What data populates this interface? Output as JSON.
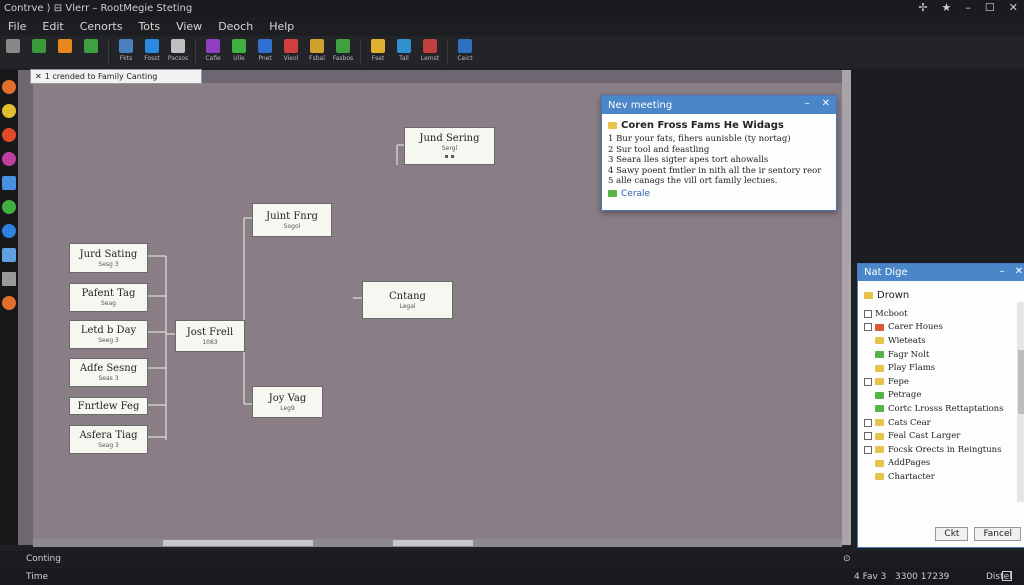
{
  "window": {
    "title": "Contrve ⟩ ⊟ Vlerr – RootMegie Steting"
  },
  "menu": [
    "File",
    "Edit",
    "Cenorts",
    "Tots",
    "View",
    "Deoch",
    "Help"
  ],
  "toolbar": [
    {
      "icon": "gear-icon",
      "label": "",
      "color": "#888"
    },
    {
      "icon": "moon-icon",
      "label": "",
      "color": "#3a9a3a"
    },
    {
      "icon": "hammer-icon",
      "label": "",
      "color": "#e8861c"
    },
    {
      "icon": "leaf-icon",
      "label": "",
      "color": "#40a040"
    },
    {
      "icon": "globe-icon",
      "label": "Fkts",
      "color": "#4a7fc0"
    },
    {
      "icon": "diamond-icon",
      "label": "Fosst",
      "color": "#2a8ae0"
    },
    {
      "icon": "pie-icon",
      "label": "Pacsos",
      "color": "#c0c0c0"
    },
    {
      "icon": "color-wheel-icon",
      "label": "Cafie",
      "color": "#9040c0"
    },
    {
      "icon": "pencil-icon",
      "label": "Ulle",
      "color": "#40b040"
    },
    {
      "icon": "search-icon",
      "label": "Pnet",
      "color": "#3070d0"
    },
    {
      "icon": "grid-icon",
      "label": "Vieol",
      "color": "#d04040"
    },
    {
      "icon": "chart-icon",
      "label": "Fsbal",
      "color": "#d0a030"
    },
    {
      "icon": "table-icon",
      "label": "Fasbos",
      "color": "#40a040"
    },
    {
      "icon": "book-icon",
      "label": "Fset",
      "color": "#e0b030"
    },
    {
      "icon": "image-icon",
      "label": "Tall",
      "color": "#3090d0"
    },
    {
      "icon": "video-icon",
      "label": "Lemst",
      "color": "#c04040"
    },
    {
      "icon": "door-icon",
      "label": "Ceict",
      "color": "#3070c0"
    }
  ],
  "tab": {
    "label": "1 crended to Family Canting"
  },
  "tree": {
    "nodes": [
      {
        "name": "Jund Sering",
        "sub": "Sergl"
      },
      {
        "name": "Juint Fnrg",
        "sub": "Sogol"
      },
      {
        "name": "Cntang",
        "sub": "Legal"
      },
      {
        "name": "Jost Frell",
        "sub": "1083"
      },
      {
        "name": "Joy Vag",
        "sub": "Leg9"
      },
      {
        "name": "Jurd Sating",
        "sub": "Sesg 3"
      },
      {
        "name": "Pafent Tag",
        "sub": "Seag"
      },
      {
        "name": "Letd b Day",
        "sub": "Seeg 3"
      },
      {
        "name": "Adfe Sesng",
        "sub": "Seas 3"
      },
      {
        "name": "Fnrtlew Feg",
        "sub": ""
      },
      {
        "name": "Asfera Tiag",
        "sub": "Seag 3"
      }
    ]
  },
  "dialog1": {
    "title": "Nev meeting",
    "heading": "Coren Fross Fams He Widags",
    "lines": [
      "1  Bur your fats, fihers aunisble (ty nortag)",
      "2  Sur tool and feastling",
      "3  Seara lles sigter apes tort ahowalls",
      "4  Sawy poent fmtler in nith all the ir sentory reor",
      "5  alle canags the vill ort family lectues."
    ],
    "link": "Cerale"
  },
  "dialog2": {
    "title": "Nat Dige",
    "root": "Drown",
    "items": [
      {
        "label": "Mcboot",
        "cb": true,
        "icon": ""
      },
      {
        "label": "Carer Houes",
        "cb": true,
        "icon": "r"
      },
      {
        "label": "Wieteats",
        "cb": false,
        "icon": "y"
      },
      {
        "label": "Fagr Nolt",
        "cb": false,
        "icon": "g"
      },
      {
        "label": "Play Flams",
        "cb": false,
        "icon": "y"
      },
      {
        "label": "Fepe",
        "cb": true,
        "icon": "y"
      },
      {
        "label": "Petrage",
        "cb": false,
        "icon": "g"
      },
      {
        "label": "Cortc Lrosss Rettaptations",
        "cb": false,
        "icon": "g"
      },
      {
        "label": "Cats Cear",
        "cb": true,
        "icon": "y"
      },
      {
        "label": "Feal Cast Larger",
        "cb": true,
        "icon": "y"
      },
      {
        "label": "Focsk Orects in Reingtuns",
        "cb": true,
        "icon": "y"
      },
      {
        "label": "AddPages",
        "cb": false,
        "icon": "y"
      },
      {
        "label": "Chartacter",
        "cb": false,
        "icon": "y"
      }
    ],
    "ok": "Ckt",
    "cancel": "Fancel"
  },
  "status": {
    "left1": "Conting",
    "left2": "Time",
    "right2a": "4 Fav 3",
    "right2b": "3300 17239",
    "right2c": "Distel"
  }
}
